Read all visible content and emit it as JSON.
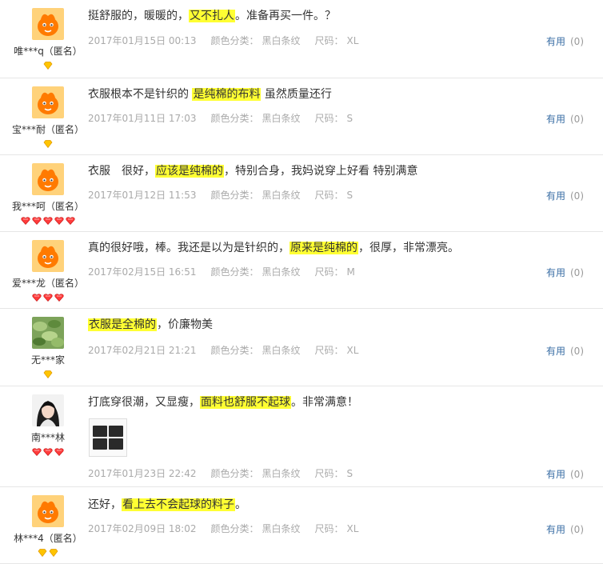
{
  "useful_label": "有用",
  "reviews": [
    {
      "username": "唯***q（匿名）",
      "avatar": "orange-mascot",
      "badges": [
        "diamond-yellow"
      ],
      "text_parts": [
        {
          "t": "挺舒服的，暖暖的，",
          "hl": false
        },
        {
          "t": "又不扎人",
          "hl": true
        },
        {
          "t": "。准备再买一件。？",
          "hl": false
        }
      ],
      "date": "2017年01月15日 00:13",
      "color_label": "颜色分类：",
      "color_value": "黑白条纹",
      "size_label": "尺码：",
      "size_value": "XL",
      "useful_count": "(0)"
    },
    {
      "username": "宝***耐（匿名）",
      "avatar": "orange-mascot",
      "badges": [
        "diamond-yellow"
      ],
      "text_parts": [
        {
          "t": "衣服根本不是针织的 ",
          "hl": false
        },
        {
          "t": "是纯棉的布料",
          "hl": true
        },
        {
          "t": " 虽然质量还行",
          "hl": false
        }
      ],
      "date": "2017年01月11日 17:03",
      "color_label": "颜色分类：",
      "color_value": "黑白条纹",
      "size_label": "尺码：",
      "size_value": "S",
      "useful_count": "(0)"
    },
    {
      "username": "我***呵（匿名）",
      "avatar": "orange-mascot",
      "badges": [
        "heart-red",
        "heart-red",
        "heart-red",
        "heart-red",
        "heart-red"
      ],
      "text_parts": [
        {
          "t": "衣服　很好，",
          "hl": false
        },
        {
          "t": "应该是纯棉的",
          "hl": true
        },
        {
          "t": "，特别合身，我妈说穿上好看 特别满意",
          "hl": false
        }
      ],
      "date": "2017年01月12日 11:53",
      "color_label": "颜色分类：",
      "color_value": "黑白条纹",
      "size_label": "尺码：",
      "size_value": "S",
      "useful_count": "(0)"
    },
    {
      "username": "爱***龙（匿名）",
      "avatar": "orange-mascot",
      "badges": [
        "heart-red",
        "heart-red",
        "heart-red"
      ],
      "text_parts": [
        {
          "t": "真的很好哦，棒。我还是以为是针织的，",
          "hl": false
        },
        {
          "t": "原来是纯棉的",
          "hl": true
        },
        {
          "t": "，很厚，非常漂亮。",
          "hl": false
        }
      ],
      "date": "2017年02月15日 16:51",
      "color_label": "颜色分类：",
      "color_value": "黑白条纹",
      "size_label": "尺码：",
      "size_value": "M",
      "useful_count": "(0)"
    },
    {
      "username": "无***家",
      "avatar": "green-leaves",
      "badges": [
        "diamond-yellow"
      ],
      "text_parts": [
        {
          "t": "衣服是全棉的",
          "hl": true
        },
        {
          "t": "，价廉物美",
          "hl": false
        }
      ],
      "date": "2017年02月21日 21:21",
      "color_label": "颜色分类：",
      "color_value": "黑白条纹",
      "size_label": "尺码：",
      "size_value": "XL",
      "useful_count": "(0)"
    },
    {
      "username": "南***林",
      "avatar": "woman-portrait",
      "badges": [
        "heart-red",
        "heart-red",
        "heart-red"
      ],
      "text_parts": [
        {
          "t": "打底穿很潮，又显瘦，",
          "hl": false
        },
        {
          "t": "面料也舒服不起球",
          "hl": true
        },
        {
          "t": "。非常满意！",
          "hl": false
        }
      ],
      "has_photo": true,
      "date": "2017年01月23日 22:42",
      "color_label": "颜色分类：",
      "color_value": "黑白条纹",
      "size_label": "尺码：",
      "size_value": "S",
      "useful_count": "(0)"
    },
    {
      "username": "林***4（匿名）",
      "avatar": "orange-mascot",
      "badges": [
        "diamond-yellow",
        "diamond-yellow"
      ],
      "text_parts": [
        {
          "t": "还好，",
          "hl": false
        },
        {
          "t": "看上去不会起球的料子",
          "hl": true
        },
        {
          "t": "。",
          "hl": false
        }
      ],
      "date": "2017年02月09日 18:02",
      "color_label": "颜色分类：",
      "color_value": "黑白条纹",
      "size_label": "尺码：",
      "size_value": "XL",
      "useful_count": "(0)"
    }
  ]
}
